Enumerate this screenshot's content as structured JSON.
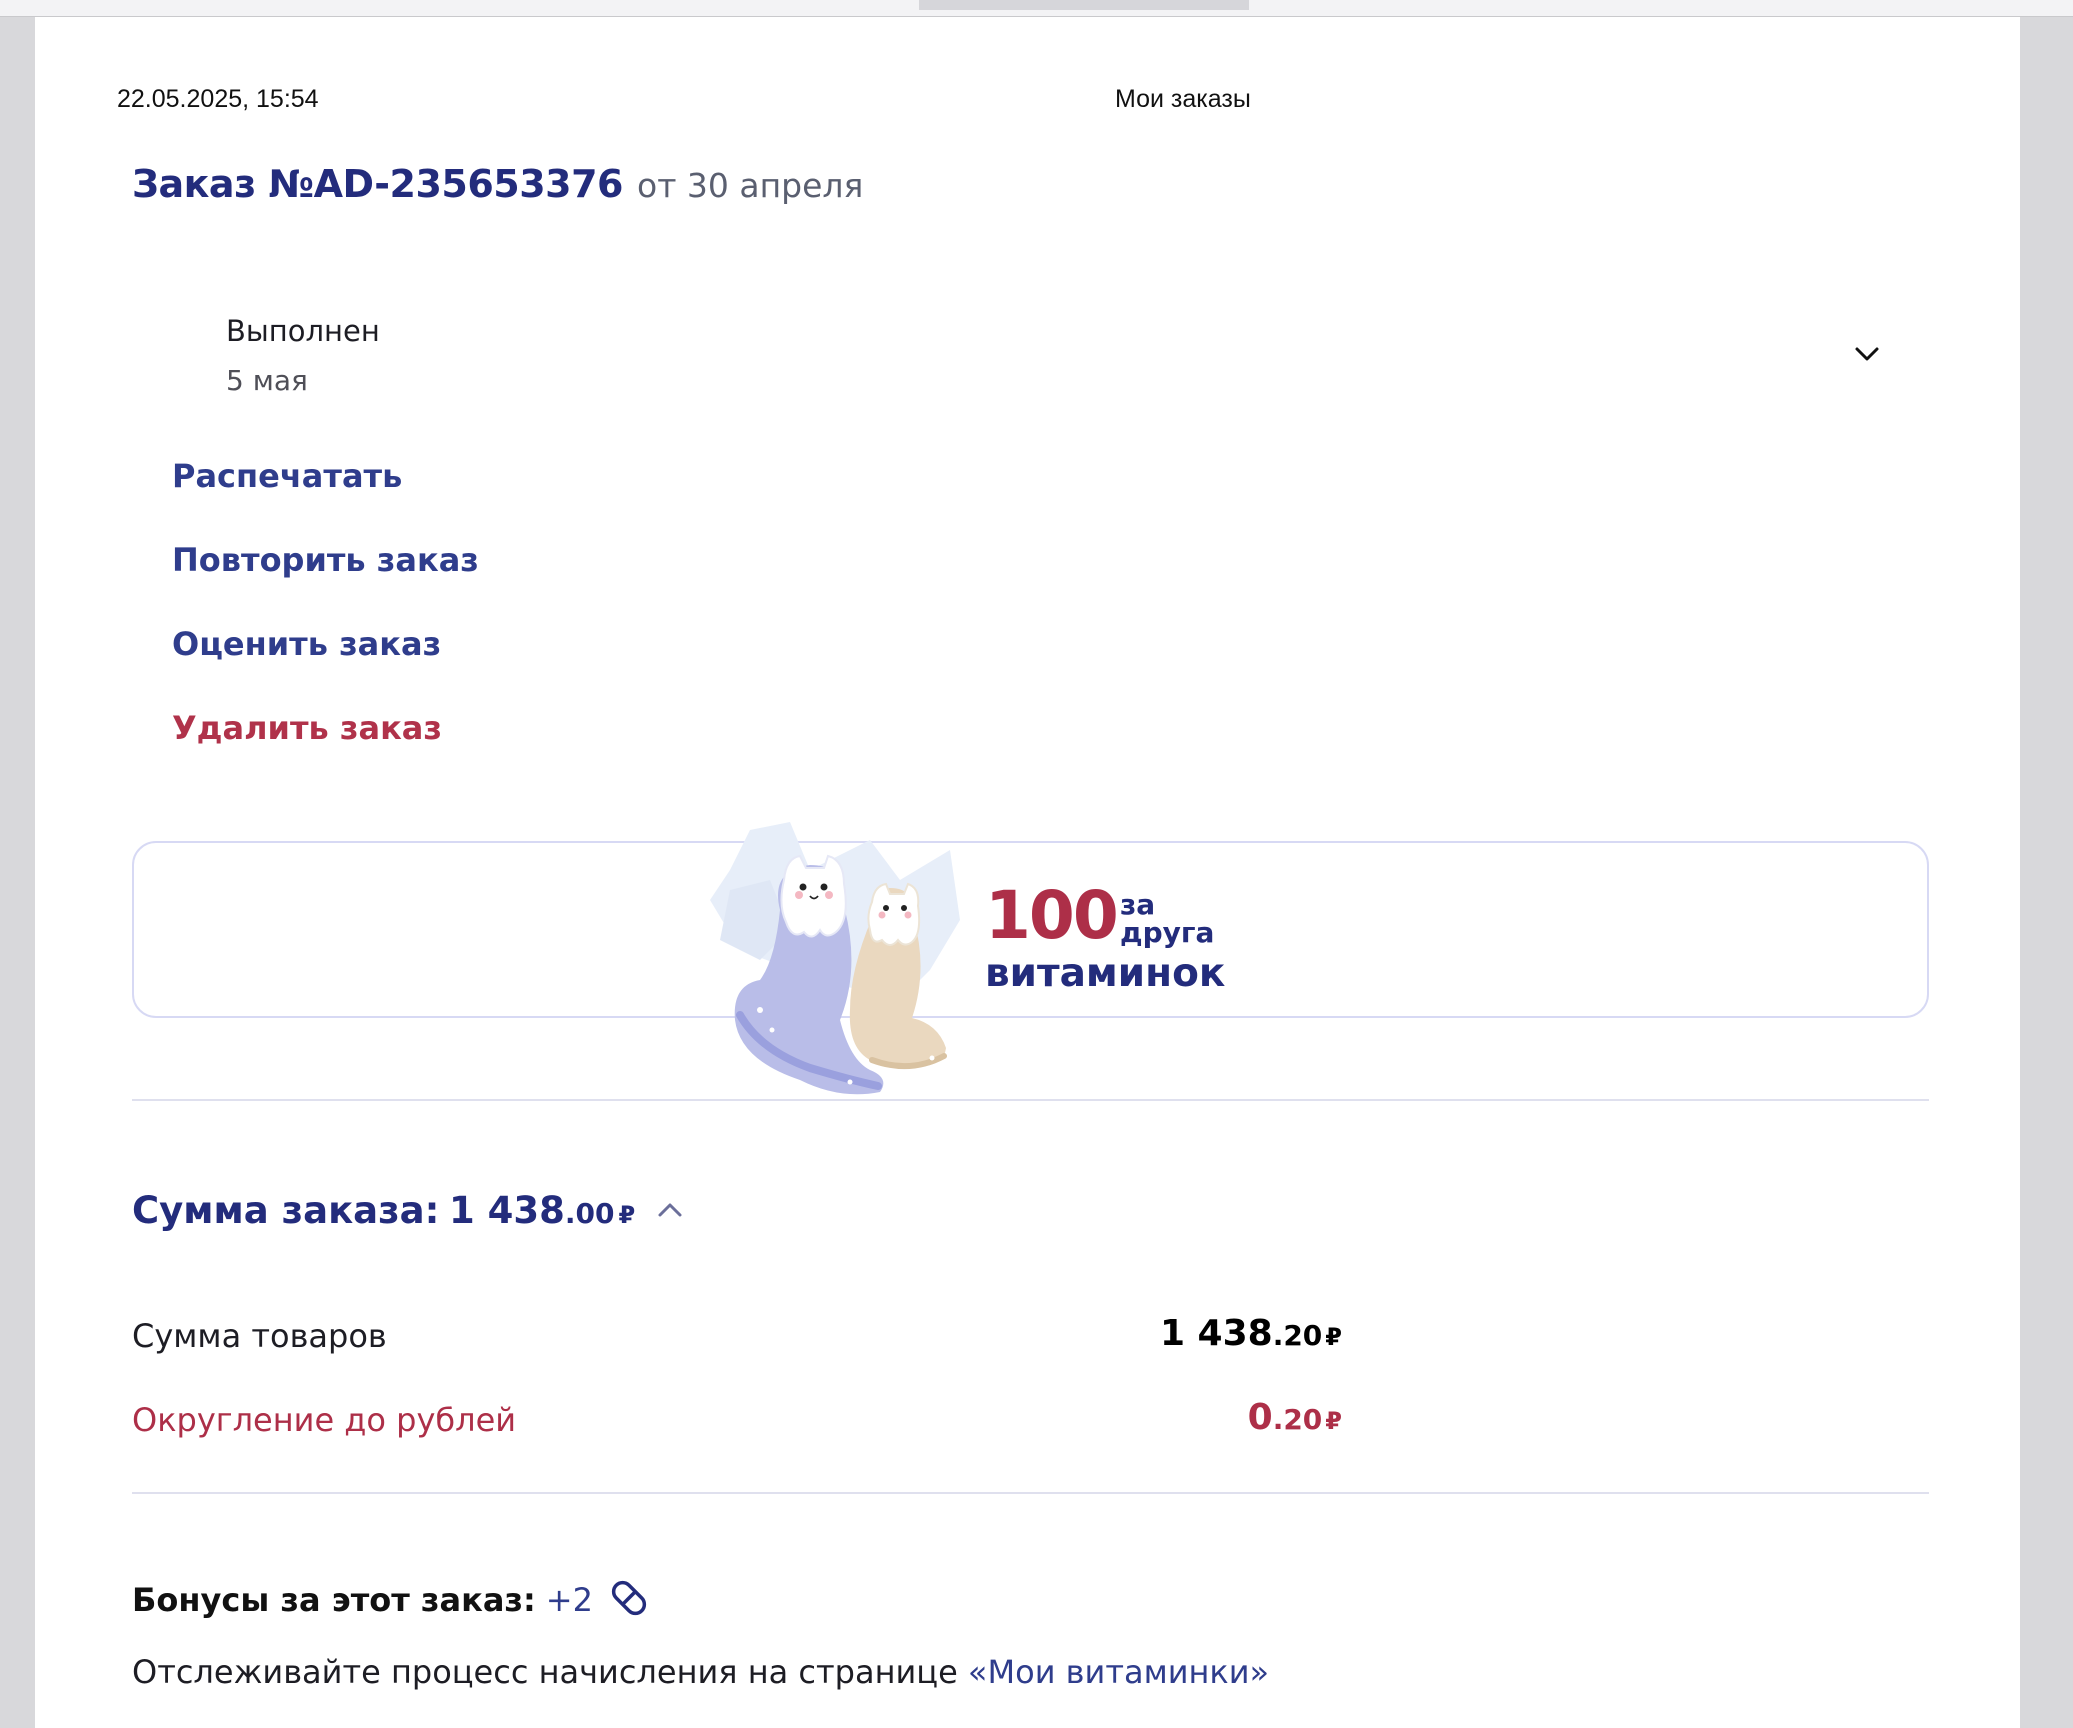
{
  "print_header": {
    "datetime": "22.05.2025, 15:54",
    "title": "Мои заказы"
  },
  "order": {
    "number": "Заказ №AD-235653376",
    "date": "от 30 апреля"
  },
  "status": {
    "label": "Выполнен",
    "date": "5 мая"
  },
  "actions": [
    {
      "label": "Распечатать"
    },
    {
      "label": "Повторить заказ"
    },
    {
      "label": "Оценить заказ"
    },
    {
      "label": "Удалить заказ"
    }
  ],
  "promo": {
    "amount": "100",
    "for_line1": "за",
    "for_line2": "друга",
    "unit": "витаминок"
  },
  "summary": {
    "label": "Сумма заказа:",
    "total_int": "1 438",
    "total_kop": ".00",
    "currency": "₽"
  },
  "breakdown": [
    {
      "label": "Сумма товаров",
      "int": "1 438",
      "kop": ".20",
      "currency": "₽"
    },
    {
      "label": "Округление до рублей",
      "int": "0",
      "kop": ".20",
      "currency": "₽"
    }
  ],
  "bonus": {
    "label": "Бонусы за этот заказ:",
    "value": "+2",
    "icon": "pill-icon"
  },
  "tracking": {
    "text": "Отслеживайте процесс начисления на странице ",
    "link": "«Мои витаминки»"
  },
  "colors": {
    "brand_navy": "#232c7c",
    "link_blue": "#2f3d8c",
    "danger_red": "#ad2f48",
    "card_border": "#d7d9f4"
  }
}
